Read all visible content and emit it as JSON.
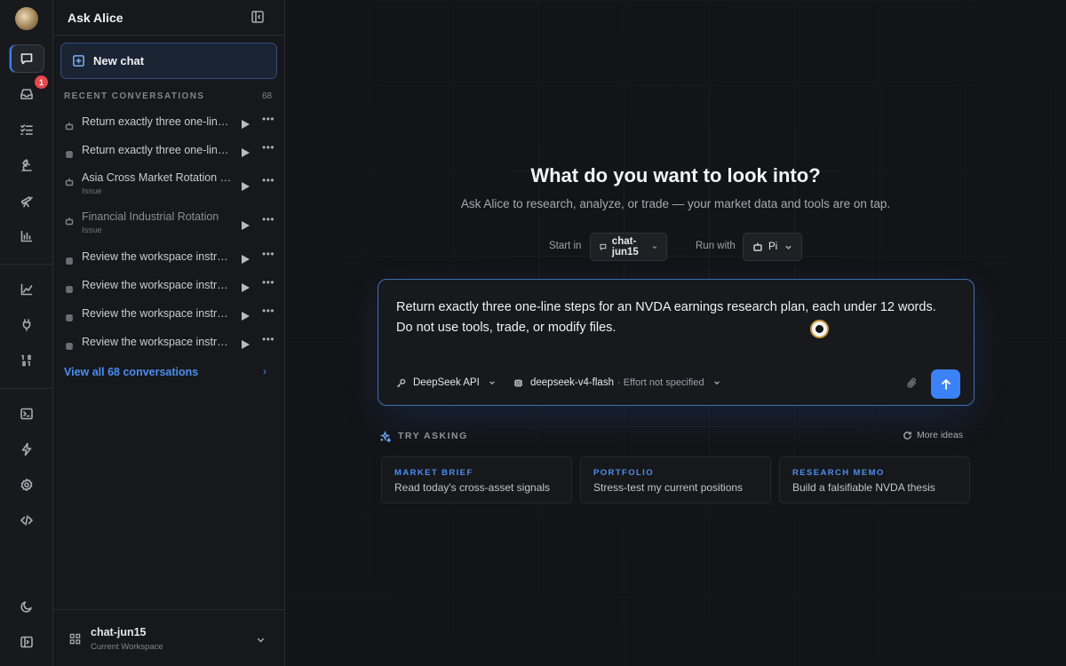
{
  "sidebar": {
    "title": "Ask Alice",
    "new_chat_label": "New chat",
    "section_label": "RECENT CONVERSATIONS",
    "section_count": "68",
    "conversations": [
      {
        "title": "Return exactly three one-line steps for an NVDA earnings research plan",
        "subtitle": "",
        "icon": "robot-icon",
        "dim": false
      },
      {
        "title": "Return exactly three one-line steps for an NVDA earnings research plan",
        "subtitle": "",
        "icon": "chip-icon",
        "dim": false
      },
      {
        "title": "Asia Cross Market Rotation Issue",
        "subtitle": "Issue",
        "icon": "robot-icon",
        "dim": false
      },
      {
        "title": "Financial Industrial Rotation",
        "subtitle": "Issue",
        "icon": "robot-icon",
        "dim": true
      },
      {
        "title": "Review the workspace instructions",
        "subtitle": "",
        "icon": "chip-icon",
        "dim": false
      },
      {
        "title": "Review the workspace instructions",
        "subtitle": "",
        "icon": "chip-icon",
        "dim": false
      },
      {
        "title": "Review the workspace instructions",
        "subtitle": "",
        "icon": "chip-icon",
        "dim": false
      },
      {
        "title": "Review the workspace instructions",
        "subtitle": "",
        "icon": "chip-icon",
        "dim": false
      }
    ],
    "view_all_label": "View all 68 conversations",
    "workspace": {
      "name": "chat-jun15",
      "subtitle": "Current Workspace"
    }
  },
  "rail": {
    "inbox_badge": "1"
  },
  "main": {
    "title": "What do you want to look into?",
    "subtitle": "Ask Alice to research, analyze, or trade — your market data and tools are on tap.",
    "start_in_label": "Start in",
    "start_in_value": "chat-jun15",
    "run_with_label": "Run with",
    "run_with_value": "Pi",
    "composer": {
      "text": "Return exactly three one-line steps for an NVDA earnings research plan, each under 12 words. Do not use tools, trade, or modify files.",
      "provider": "DeepSeek API",
      "model": "deepseek-v4-flash",
      "effort": "· Effort not specified"
    },
    "try_asking_label": "TRY ASKING",
    "more_ideas_label": "More ideas",
    "suggestions": [
      {
        "kind": "MARKET BRIEF",
        "text": "Read today's cross-asset signals"
      },
      {
        "kind": "PORTFOLIO",
        "text": "Stress-test my current positions"
      },
      {
        "kind": "RESEARCH MEMO",
        "text": "Build a falsifiable NVDA thesis"
      }
    ]
  },
  "colors": {
    "accent": "#3b82f6",
    "badge": "#e5484d",
    "background": "#131417"
  }
}
